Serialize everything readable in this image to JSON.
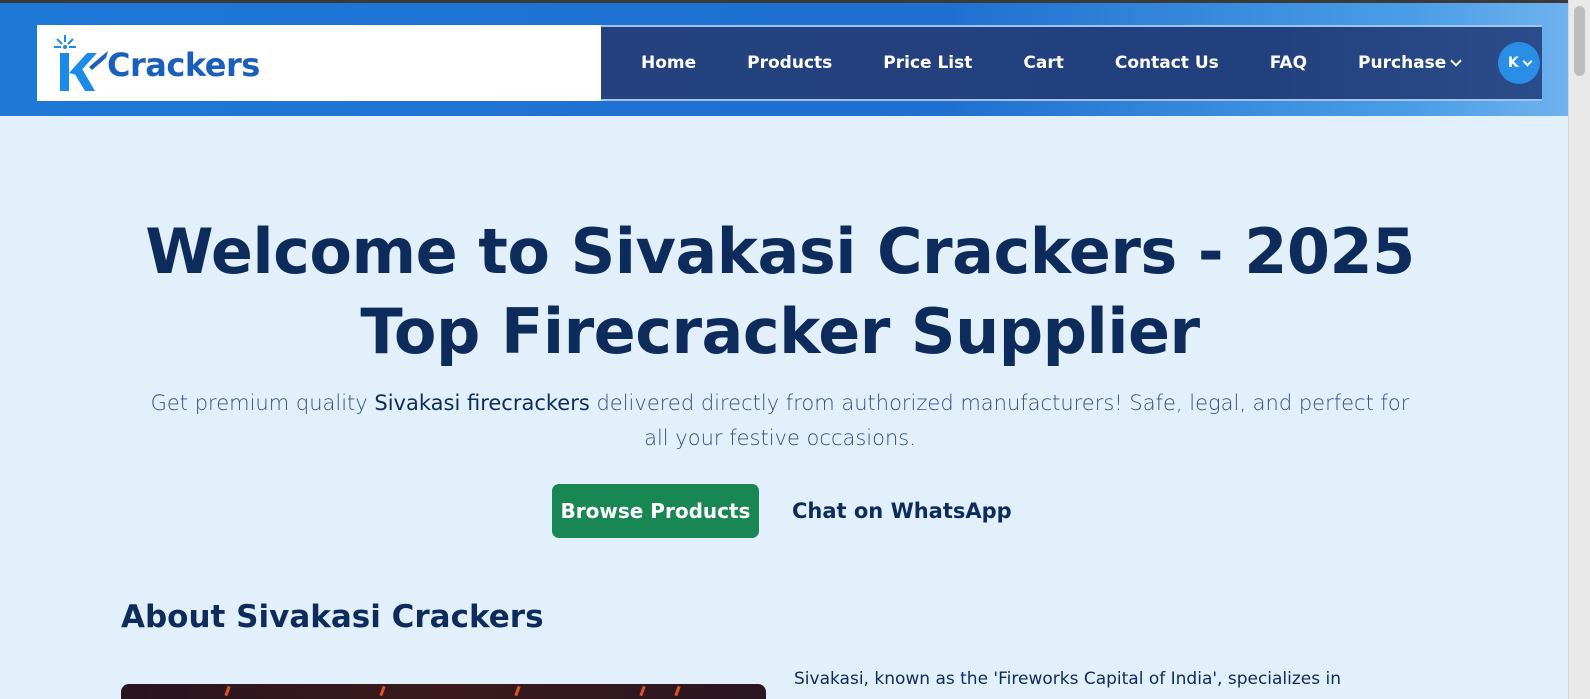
{
  "logo": {
    "mark": "K",
    "text": "Crackers"
  },
  "nav": {
    "items": [
      {
        "label": "Home"
      },
      {
        "label": "Products"
      },
      {
        "label": "Price List"
      },
      {
        "label": "Cart"
      },
      {
        "label": "Contact Us"
      },
      {
        "label": "FAQ"
      }
    ],
    "purchase_label": "Purchase",
    "avatar_initial": "K"
  },
  "hero": {
    "title": "Welcome to Sivakasi Crackers - 2025 Top Firecracker Supplier",
    "subtitle_pre": "Get premium quality ",
    "subtitle_strong": "Sivakasi firecrackers",
    "subtitle_post": " delivered directly from authorized manufacturers! Safe, legal, and perfect for all your festive occasions.",
    "browse_button": "Browse Products",
    "whatsapp_button": "Chat on WhatsApp"
  },
  "about": {
    "title": "About Sivakasi Crackers",
    "text": "Sivakasi, known as the 'Fireworks Capital of India', specializes in"
  },
  "colors": {
    "header_gradient_start": "#1e78d6",
    "nav_background": "#25427f",
    "page_background": "#e2f0fc",
    "heading_text": "#0d2c5c",
    "browse_button": "#198754",
    "avatar": "#2a8de6"
  }
}
